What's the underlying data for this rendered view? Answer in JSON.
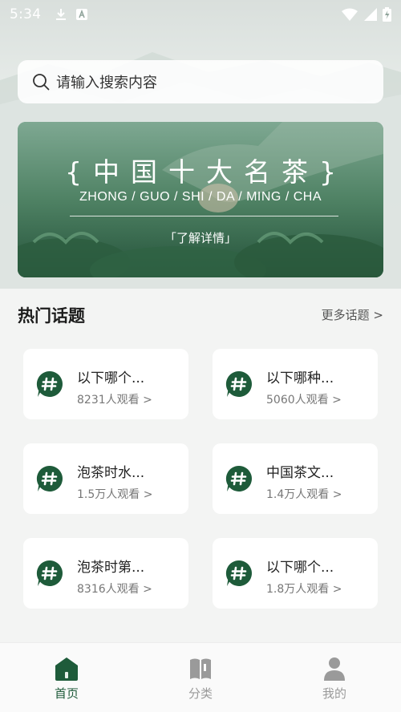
{
  "status_bar": {
    "time": "5:34"
  },
  "search": {
    "placeholder": "请输入搜索内容"
  },
  "banner": {
    "title": "{中国十大名茶}",
    "subtitle": "ZHONG / GUO / SHI / DA / MING / CHA",
    "link": "「了解详情」"
  },
  "hot_topics": {
    "title": "热门话题",
    "more": "更多话题 >",
    "items": [
      {
        "title": "以下哪个...",
        "views": "8231人观看 >"
      },
      {
        "title": "以下哪种...",
        "views": "5060人观看 >"
      },
      {
        "title": "泡茶时水...",
        "views": "1.5万人观看 >"
      },
      {
        "title": "中国茶文...",
        "views": "1.4万人观看 >"
      },
      {
        "title": "泡茶时第...",
        "views": "8316人观看 >"
      },
      {
        "title": "以下哪个...",
        "views": "1.8万人观看 >"
      }
    ]
  },
  "bottom_nav": {
    "items": [
      {
        "label": "首页",
        "icon": "home-icon",
        "active": true
      },
      {
        "label": "分类",
        "icon": "book-icon",
        "active": false
      },
      {
        "label": "我的",
        "icon": "person-icon",
        "active": false
      }
    ]
  },
  "colors": {
    "accent": "#1e5b3a",
    "banner": "#3e6f53",
    "background": "#f3f4f3"
  }
}
